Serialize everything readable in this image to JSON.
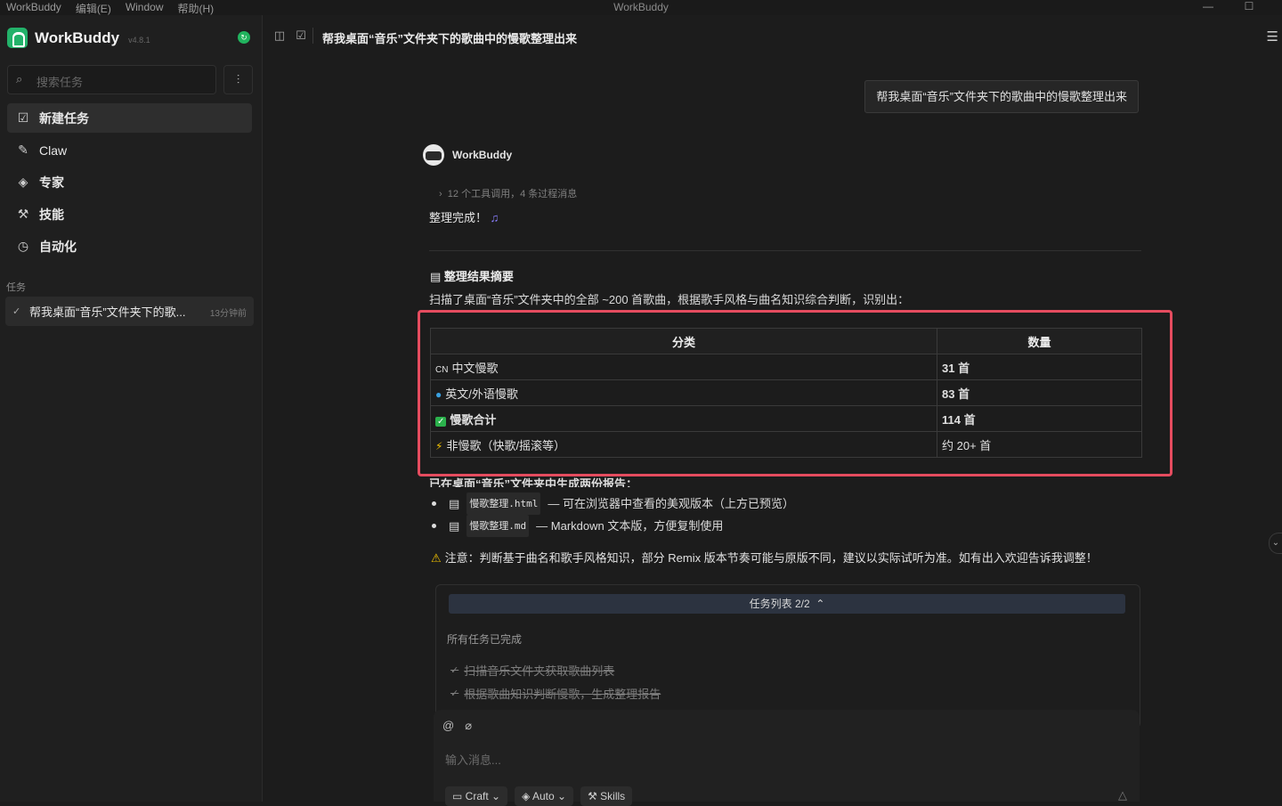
{
  "titlebar": {
    "menus": [
      "WorkBuddy",
      "编辑(E)",
      "Window",
      "帮助(H)"
    ],
    "window_title": "WorkBuddy",
    "minimize": "—",
    "maximize": "☐"
  },
  "sidebar": {
    "brand": "WorkBuddy",
    "version": "v4.8.1",
    "search_placeholder": "搜索任务",
    "nav": [
      {
        "label": "新建任务",
        "icon": "edit-square-icon"
      },
      {
        "label": "Claw",
        "icon": "claw-icon"
      },
      {
        "label": "专家",
        "icon": "graduation-cap-icon"
      },
      {
        "label": "技能",
        "icon": "magic-wand-icon"
      },
      {
        "label": "自动化",
        "icon": "clock-icon"
      }
    ],
    "section_label": "任务",
    "task": {
      "title": "帮我桌面“音乐”文件夹下的歌...",
      "time": "13分钟前"
    }
  },
  "topbar": {
    "title": "帮我桌面“音乐”文件夹下的歌曲中的慢歌整理出来"
  },
  "chat": {
    "user_message": "帮我桌面“音乐”文件夹下的歌曲中的慢歌整理出来",
    "bot_name": "WorkBuddy",
    "tool_calls": "12 个工具调用，4 条过程消息",
    "done_text": "整理完成！",
    "summary_heading": "整理结果摘要",
    "summary_text": "扫描了桌面“音乐”文件夹中的全部 ~200 首歌曲，根据歌手风格与曲名知识综合判断，识别出：",
    "table": {
      "headers": [
        "分类",
        "数量"
      ],
      "rows": [
        {
          "icon": "CN",
          "category": "中文慢歌",
          "count": "31 首",
          "bold": false
        },
        {
          "icon": "globe-icon",
          "category": "英文/外语慢歌",
          "count": "83 首",
          "bold": false
        },
        {
          "icon": "check-box-icon",
          "category": "慢歌合计",
          "count": "114 首",
          "bold": true
        },
        {
          "icon": "lightning-icon",
          "category": "非慢歌（快歌/摇滚等）",
          "count": "约 20+ 首",
          "bold": false
        }
      ]
    },
    "report_heading": "已在桌面“音乐”文件夹中生成两份报告：",
    "files": [
      {
        "name": "慢歌整理.html",
        "desc": "— 可在浏览器中查看的美观版本（上方已预览）"
      },
      {
        "name": "慢歌整理.md",
        "desc": "— Markdown 文本版，方便复制使用"
      }
    ],
    "warning": "注意：判断基于曲名和歌手风格知识，部分 Remix 版本节奏可能与原版不同，建议以实际试听为准。如有出入欢迎告诉我调整！",
    "task_list": {
      "header": "任务列表 2/2",
      "status": "所有任务已完成",
      "items": [
        "扫描音乐文件夹获取歌曲列表",
        "根据歌曲知识判断慢歌，生成整理报告"
      ]
    }
  },
  "composer": {
    "placeholder": "输入消息...",
    "chips": [
      "Craft",
      "Auto",
      "Skills"
    ]
  },
  "colors": {
    "accent": "#23b26a",
    "highlight_border": "#e54c5f",
    "background": "#1c1c1c"
  }
}
